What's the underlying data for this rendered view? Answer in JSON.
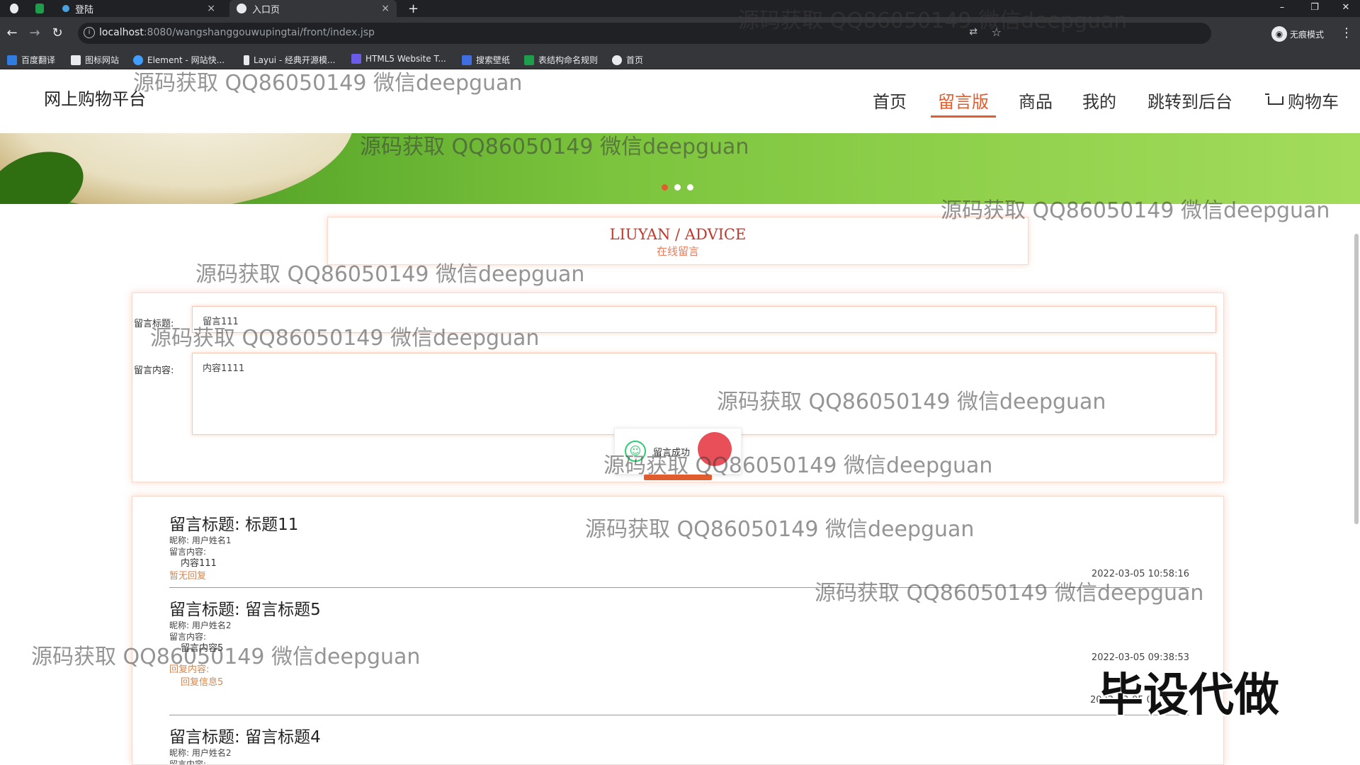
{
  "browser": {
    "tabs": [
      {
        "label": "登陆"
      },
      {
        "label": "入口页"
      }
    ],
    "new_tab": "+",
    "tab_close": "×",
    "url_host": "localhost",
    "url_path": ":8080/wangshanggouwupingtai/front/index.jsp",
    "incognito": "无痕模式",
    "bookmarks": [
      {
        "label": "百度翻译"
      },
      {
        "label": "图标网站"
      },
      {
        "label": "Element - 网站快..."
      },
      {
        "label": "Layui - 经典开源模..."
      },
      {
        "label": "HTML5 Website T..."
      },
      {
        "label": "搜索壁纸"
      },
      {
        "label": "表结构命名规则"
      },
      {
        "label": "首页"
      }
    ],
    "colors": {
      "chrome_dark": "#202124",
      "chrome_mid": "#35363a",
      "text": "#e8eaed"
    }
  },
  "site": {
    "logo": "网上购物平台",
    "nav": [
      {
        "label": "首页"
      },
      {
        "label": "留言版"
      },
      {
        "label": "商品"
      },
      {
        "label": "我的"
      },
      {
        "label": "跳转到后台"
      },
      {
        "label": "购物车"
      }
    ],
    "active_nav": "留言版",
    "accent": "#e25d2e"
  },
  "banner": {
    "slides": 3,
    "active_slide": 1
  },
  "section": {
    "title_en": "LIUYAN / ADVICE",
    "title_cn": "在线留言"
  },
  "form": {
    "title_label": "留言标题:",
    "title_value": "留言111",
    "content_label": "留言内容:",
    "content_value": "内容1111",
    "toast": "留言成功"
  },
  "messages": [
    {
      "title_label": "留言标题:",
      "title": "标题11",
      "nickname": "昵称: 用户姓名1",
      "content_label": "留言内容:",
      "content": "内容111",
      "reply_label": "暂无回复",
      "reply": "",
      "time": "2022-03-05 10:58:16"
    },
    {
      "title_label": "留言标题:",
      "title": "留言标题5",
      "nickname": "昵称: 用户姓名2",
      "content_label": "留言内容:",
      "content": "留言内容5",
      "reply_label": "回复内容:",
      "reply": "回复信息5",
      "time": "2022-03-05 09:38:53"
    },
    {
      "title_label": "留言标题:",
      "title": "留言标题4",
      "nickname": "昵称: 用户姓名2",
      "content_label": "留言内容:",
      "content": "",
      "reply_label": "",
      "reply": "",
      "time": "2022-03-05 0..."
    }
  ],
  "watermark": "源码获取 QQ86050149 微信deepguan",
  "big_watermark": "毕设代做"
}
